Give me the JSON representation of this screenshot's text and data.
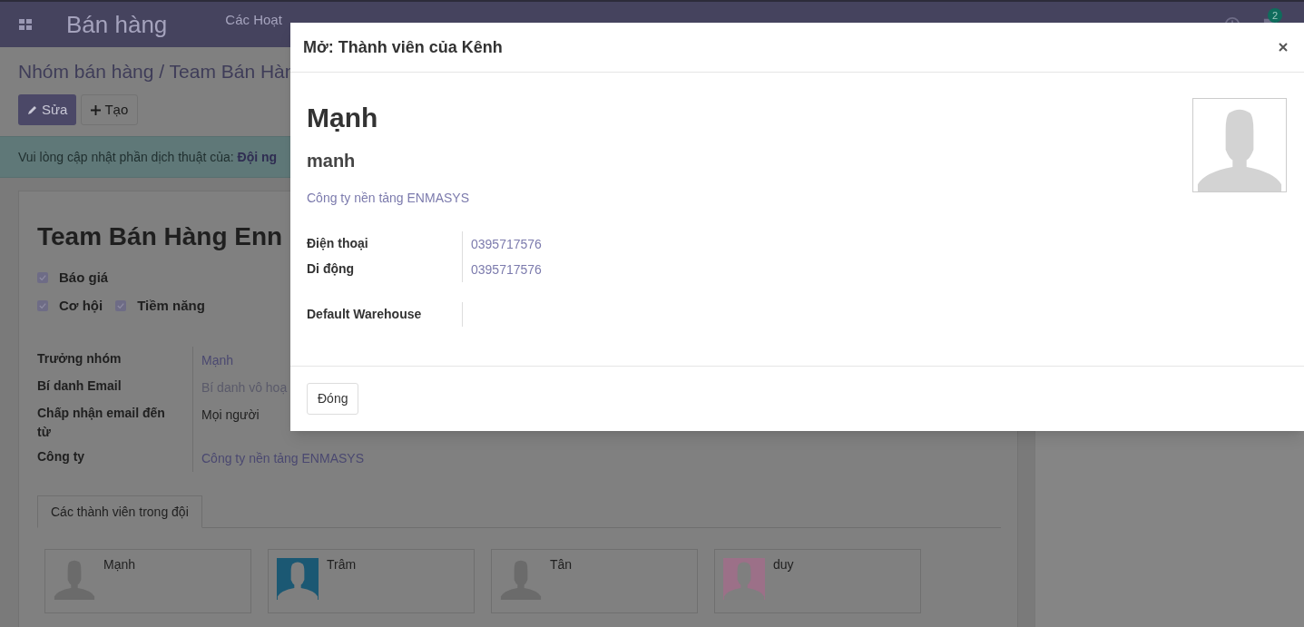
{
  "navbar": {
    "app_title": "Bán hàng",
    "menu": [
      "Các Hoạt"
    ],
    "chat_badge": "2"
  },
  "breadcrumb": "Nhóm bán hàng / Team Bán Hàn",
  "buttons": [
    {
      "label": "Sửa",
      "kind": "primary"
    },
    {
      "label": "Tạo",
      "kind": "secondary"
    }
  ],
  "alert": {
    "text": "Vui lòng cập nhật phần dịch thuật của:",
    "link": "Đội ng"
  },
  "record": {
    "title": "Team Bán Hàng Enn",
    "options": [
      {
        "label": "Báo giá",
        "checked": true
      },
      {
        "label": "Cơ hội",
        "checked": true
      },
      {
        "label": "Tiềm năng",
        "checked": true
      }
    ],
    "fields": [
      {
        "label": "Trưởng nhóm",
        "value": "Mạnh",
        "kind": "link"
      },
      {
        "label": "Bí danh Email",
        "placeholder": "Bí danh vô hoạ",
        "kind": "muted"
      },
      {
        "label": "Chấp nhận email đến từ",
        "value": "Mọi người",
        "kind": "text"
      },
      {
        "label": "Công ty",
        "value": "Công ty nền tảng ENMASYS",
        "kind": "link"
      }
    ],
    "tabs": [
      {
        "label": "Các thành viên trong đội",
        "selected": true
      }
    ],
    "members": [
      {
        "name": "Mạnh",
        "kind": "default"
      },
      {
        "name": "Trâm",
        "kind": "colored",
        "color": "#1b5873"
      },
      {
        "name": "Tân",
        "kind": "default"
      },
      {
        "name": "duy",
        "kind": "colored",
        "color": "#9c7088"
      }
    ]
  },
  "dialog": {
    "title": "Mở: Thành viên của Kênh",
    "name": "Mạnh",
    "login": "manh",
    "company": "Công ty nền tảng ENMASYS",
    "fields": [
      {
        "label": "Điện thoại",
        "value": "0395717576"
      },
      {
        "label": "Di động",
        "value": "0395717576"
      },
      {
        "label": "Default Warehouse"
      }
    ],
    "close_button": "Đóng"
  }
}
